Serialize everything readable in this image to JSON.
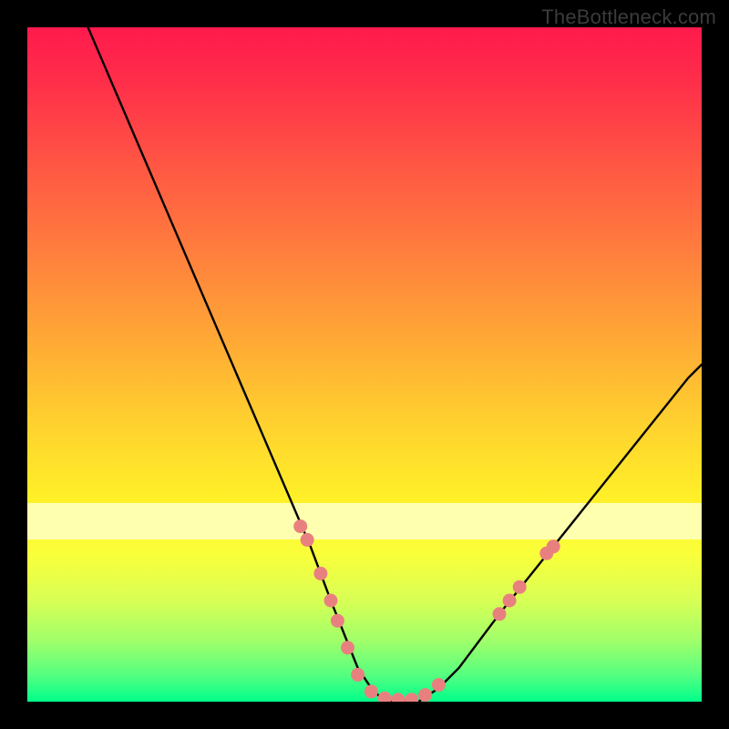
{
  "watermark": {
    "text": "TheBottleneck.com"
  },
  "chart_data": {
    "type": "line",
    "title": "",
    "xlabel": "",
    "ylabel": "",
    "xlim": [
      0,
      100
    ],
    "ylim": [
      0,
      100
    ],
    "grid": false,
    "legend": false,
    "series": [
      {
        "name": "bottleneck-curve",
        "x": [
          9,
          12,
          15,
          18,
          21,
          24,
          27,
          30,
          33,
          36,
          39,
          42,
          45,
          47,
          49,
          51,
          53,
          55,
          58,
          61,
          64,
          67,
          70,
          74,
          78,
          82,
          86,
          90,
          94,
          98,
          100
        ],
        "y": [
          100,
          93,
          86,
          79,
          72,
          65,
          58,
          51,
          44,
          37,
          30,
          23,
          15,
          10,
          5,
          2,
          0,
          0,
          0,
          2,
          5,
          9,
          13,
          18,
          23,
          28,
          33,
          38,
          43,
          48,
          50
        ]
      }
    ],
    "markers": {
      "name": "highlight-dots",
      "color": "#e98080",
      "points": [
        {
          "x": 40.5,
          "y": 26
        },
        {
          "x": 41.5,
          "y": 24
        },
        {
          "x": 43.5,
          "y": 19
        },
        {
          "x": 45.0,
          "y": 15
        },
        {
          "x": 46.0,
          "y": 12
        },
        {
          "x": 47.5,
          "y": 8
        },
        {
          "x": 49.0,
          "y": 4
        },
        {
          "x": 51.0,
          "y": 1.5
        },
        {
          "x": 53.0,
          "y": 0.5
        },
        {
          "x": 55.0,
          "y": 0.3
        },
        {
          "x": 57.0,
          "y": 0.3
        },
        {
          "x": 59.0,
          "y": 1
        },
        {
          "x": 61.0,
          "y": 2.5
        },
        {
          "x": 70.0,
          "y": 13
        },
        {
          "x": 71.5,
          "y": 15
        },
        {
          "x": 73.0,
          "y": 17
        },
        {
          "x": 77.0,
          "y": 22
        },
        {
          "x": 78.0,
          "y": 23
        }
      ]
    },
    "gradient_stops": [
      {
        "pos": 0,
        "color": "#ff1a4d"
      },
      {
        "pos": 20,
        "color": "#ff5544"
      },
      {
        "pos": 45,
        "color": "#ffa436"
      },
      {
        "pos": 70,
        "color": "#fff028"
      },
      {
        "pos": 100,
        "color": "#00ff8a"
      }
    ]
  }
}
